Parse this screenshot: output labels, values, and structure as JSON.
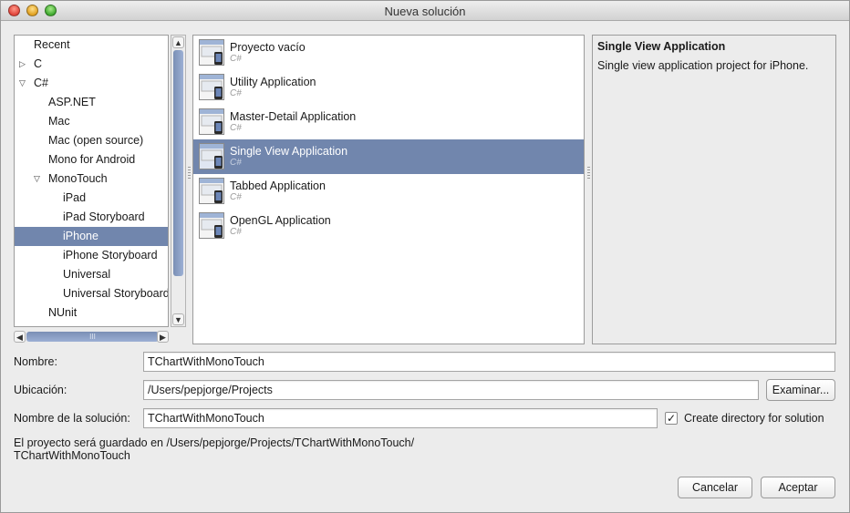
{
  "window": {
    "title": "Nueva solución"
  },
  "tree": {
    "items": [
      {
        "label": "Recent",
        "level": 0,
        "arrow": ""
      },
      {
        "label": "C",
        "level": 0,
        "arrow": "▷"
      },
      {
        "label": "C#",
        "level": 0,
        "arrow": "▽"
      },
      {
        "label": "ASP.NET",
        "level": 1,
        "arrow": ""
      },
      {
        "label": "Mac",
        "level": 1,
        "arrow": ""
      },
      {
        "label": "Mac (open source)",
        "level": 1,
        "arrow": ""
      },
      {
        "label": "Mono for Android",
        "level": 1,
        "arrow": ""
      },
      {
        "label": "MonoTouch",
        "level": 1,
        "arrow": "▽"
      },
      {
        "label": "iPad",
        "level": 2,
        "arrow": ""
      },
      {
        "label": "iPad Storyboard",
        "level": 2,
        "arrow": ""
      },
      {
        "label": "iPhone",
        "level": 2,
        "arrow": "",
        "selected": true
      },
      {
        "label": "iPhone Storyboard",
        "level": 2,
        "arrow": ""
      },
      {
        "label": "Universal",
        "level": 2,
        "arrow": ""
      },
      {
        "label": "Universal Storyboard",
        "level": 2,
        "arrow": ""
      },
      {
        "label": "NUnit",
        "level": 1,
        "arrow": ""
      }
    ],
    "hscroll_grip": "III"
  },
  "templates": [
    {
      "name": "Proyecto vacío",
      "lang": "C#"
    },
    {
      "name": "Utility Application",
      "lang": "C#"
    },
    {
      "name": "Master-Detail Application",
      "lang": "C#"
    },
    {
      "name": "Single View Application",
      "lang": "C#",
      "selected": true
    },
    {
      "name": "Tabbed Application",
      "lang": "C#"
    },
    {
      "name": "OpenGL Application",
      "lang": "C#"
    }
  ],
  "description": {
    "title": "Single View Application",
    "text": "Single view application project for iPhone."
  },
  "form": {
    "name_label": "Nombre:",
    "name_value": "TChartWithMonoTouch",
    "location_label": "Ubicación:",
    "location_value": "/Users/pepjorge/Projects",
    "browse_label": "Examinar...",
    "solution_label": "Nombre de la solución:",
    "solution_value": "TChartWithMonoTouch",
    "create_dir_label": "Create directory for solution",
    "create_dir_checked": "✓",
    "info_line1": "El proyecto será guardado en /Users/pepjorge/Projects/TChartWithMonoTouch/",
    "info_line2": "TChartWithMonoTouch"
  },
  "buttons": {
    "cancel": "Cancelar",
    "accept": "Aceptar"
  },
  "colors": {
    "selection": "#7186ad",
    "scroll_thumb": "#8ea1c5"
  }
}
